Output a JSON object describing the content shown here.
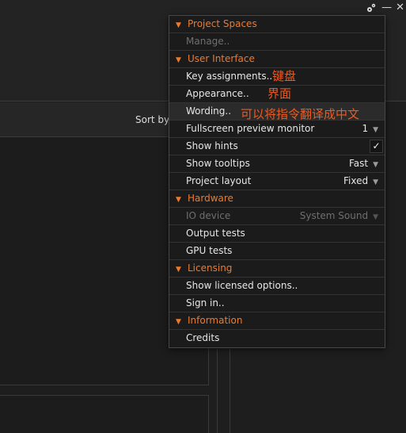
{
  "window": {
    "minimize_glyph": "—",
    "close_glyph": "✕"
  },
  "toolbar": {
    "sort_by_label": "Sort by"
  },
  "menu": {
    "sections": [
      {
        "title": "Project Spaces",
        "items": [
          {
            "label": "Manage..",
            "disabled": true
          }
        ]
      },
      {
        "title": "User Interface",
        "items": [
          {
            "label": "Key assignments.."
          },
          {
            "label": "Appearance.."
          },
          {
            "label": "Wording.."
          },
          {
            "label": "Fullscreen preview monitor",
            "value": "1"
          },
          {
            "label": "Show hints",
            "checked": true
          },
          {
            "label": "Show tooltips",
            "value": "Fast"
          },
          {
            "label": "Project layout",
            "value": "Fixed"
          }
        ]
      },
      {
        "title": "Hardware",
        "items": [
          {
            "label": "IO device",
            "value": "System Sound",
            "disabled": true
          },
          {
            "label": "Output tests"
          },
          {
            "label": "GPU tests"
          }
        ]
      },
      {
        "title": "Licensing",
        "items": [
          {
            "label": "Show licensed options.."
          },
          {
            "label": "Sign in.."
          }
        ]
      },
      {
        "title": "Information",
        "items": [
          {
            "label": "Credits"
          }
        ]
      }
    ]
  },
  "annotations": {
    "key_assignments": "键盘",
    "appearance": "界面",
    "wording": "可以将指令翻译成中文"
  },
  "colors": {
    "accent": "#ef7a2a",
    "annotation": "#f05a1e",
    "menu_bg": "#1b1b1b"
  }
}
